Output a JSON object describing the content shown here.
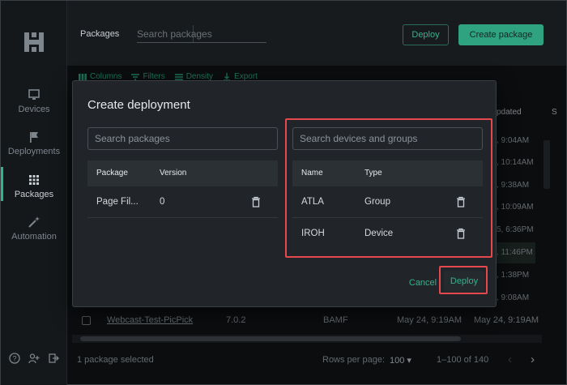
{
  "sidebar": {
    "items": [
      {
        "label": "Devices",
        "icon": "monitor-icon"
      },
      {
        "label": "Deployments",
        "icon": "flag-icon"
      },
      {
        "label": "Packages",
        "icon": "grid-icon",
        "active": true
      },
      {
        "label": "Automation",
        "icon": "magic-wand-icon"
      }
    ],
    "bottom_icons": [
      "help-icon",
      "add-user-icon",
      "logout-icon"
    ]
  },
  "topbar": {
    "title": "Packages",
    "search_placeholder": "Search packages",
    "deploy_label": "Deploy",
    "create_label": "Create package"
  },
  "table_toolbar": {
    "columns": "Columns",
    "filters": "Filters",
    "density": "Density",
    "export": "Export"
  },
  "background_table": {
    "visible_header": "pdated",
    "visible_header2": "S",
    "partial_cells": [
      ", 9:04AM",
      ", 10:14AM",
      ", 9:38AM",
      ", 10:09AM",
      "5, 6:36PM",
      ", 11:46PM",
      ", 1:38PM",
      ", 9:08AM"
    ],
    "visible_row": {
      "name": "Webcast-Test-PicPick",
      "version": "7.0.2",
      "publisher": "BAMF",
      "created": "May 24, 9:19AM",
      "updated": "May 24, 9:19AM"
    }
  },
  "footer": {
    "selected": "1 package selected",
    "rows_per_page_label": "Rows per page:",
    "rows_per_page_value": "100",
    "range": "1–100 of 140"
  },
  "modal": {
    "title": "Create deployment",
    "packages_search_placeholder": "Search packages",
    "devices_search_placeholder": "Search devices and groups",
    "packages_table": {
      "headers": [
        "Package",
        "Version"
      ],
      "rows": [
        {
          "package": "Page Fil...",
          "version": "0"
        }
      ]
    },
    "devices_table": {
      "headers": [
        "Name",
        "Type"
      ],
      "rows": [
        {
          "name": "ATLA",
          "type": "Group"
        },
        {
          "name": "IROH",
          "type": "Device"
        }
      ]
    },
    "cancel_label": "Cancel",
    "deploy_label": "Deploy"
  },
  "colors": {
    "accent": "#2fb58d",
    "highlight_outline": "#e5484d",
    "background": "#121518",
    "modal_bg": "#212529"
  }
}
